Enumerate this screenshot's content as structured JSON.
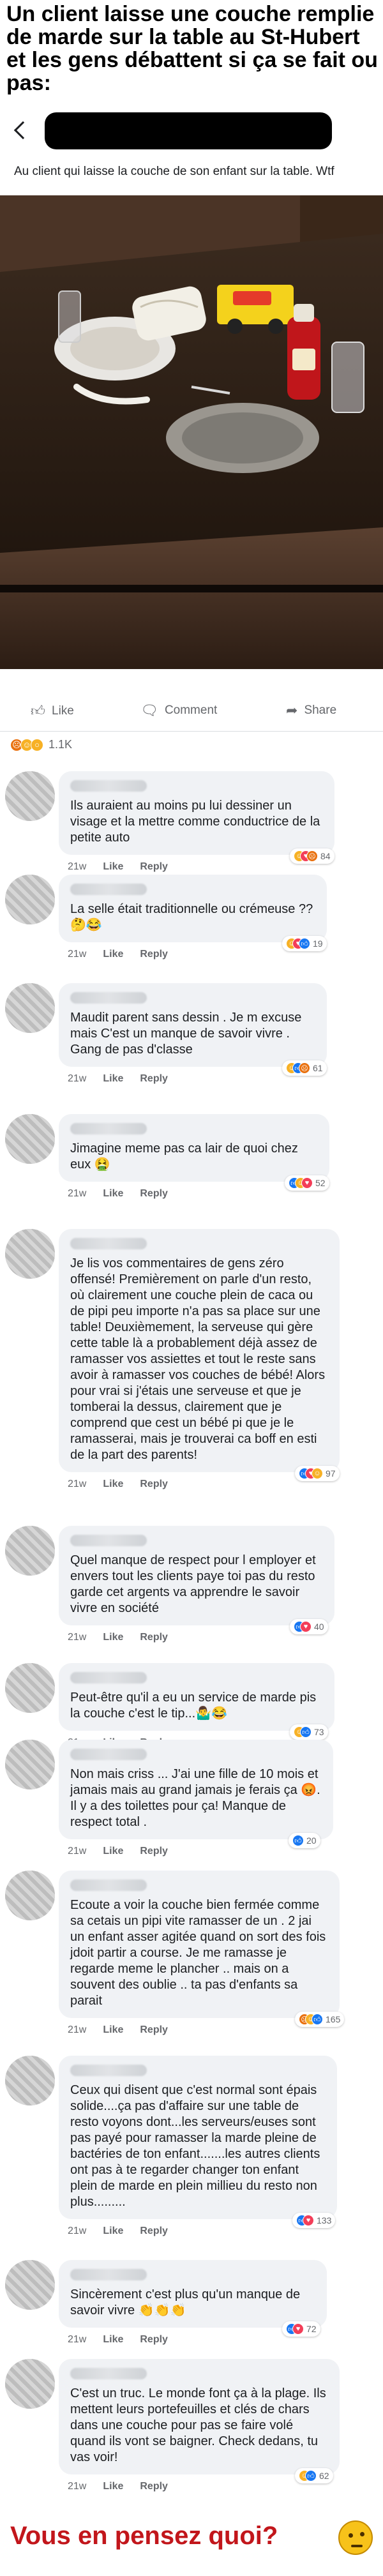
{
  "meme": {
    "title": "Un client laisse une couche remplie de marde sur la table au St-Hubert et les gens débattent si ça se fait ou pas:",
    "outro": "Vous en pensez quoi?"
  },
  "post": {
    "caption": "Au client qui laisse la couche de son enfant sur la table. Wtf",
    "photo_subject": "restaurant table with diaper, ketchup bottle, toy car box, plates and glasses"
  },
  "actions": {
    "like": "Like",
    "comment": "Comment",
    "share": "Share"
  },
  "reactions": {
    "count": "1.1K",
    "types": [
      "angry",
      "haha",
      "wow"
    ]
  },
  "comment_actions": {
    "like": "Like",
    "reply": "Reply"
  },
  "comments": [
    {
      "text": "Ils auraient au moins pu lui dessiner un visage et la mettre comme conductrice de la petite auto",
      "time": "21w",
      "reactions": [
        "haha",
        "love",
        "angry"
      ],
      "count": "84"
    },
    {
      "text": "La selle était traditionnelle ou crémeuse ?? 🤔😂",
      "time": "21w",
      "reactions": [
        "haha",
        "love",
        "like"
      ],
      "count": "19"
    },
    {
      "text": "Maudit parent sans dessin . Je m excuse mais C'est un manque de savoir vivre . Gang de pas d'classe",
      "time": "21w",
      "reactions": [
        "haha",
        "like",
        "angry"
      ],
      "count": "61"
    },
    {
      "text": "Jimagine meme pas ca lair de quoi chez eux 🤮",
      "time": "21w",
      "reactions": [
        "like",
        "haha",
        "love"
      ],
      "count": "52"
    },
    {
      "text": "Je lis vos commentaires de gens zéro offensé! Premièrement on parle d'un resto, où clairement une couche plein de caca ou de pipi peu importe n'a pas sa place sur une table! Deuxièmement, la serveuse qui gère cette table là a probablement déjà assez de ramasser vos assiettes et tout le reste sans avoir à ramasser vos couches de bébé! Alors pour vrai si j'étais une serveuse et que je tomberai la dessus, clairement que je comprend que cest un bébé pi que je le ramasserai, mais je trouverai ca boff en esti de la part des parents!",
      "time": "21w",
      "reactions": [
        "like",
        "love",
        "haha"
      ],
      "count": "97"
    },
    {
      "text": "Quel manque de respect  pour l employer et envers tout les clients  paye toi pas du resto garde cet argents va apprendre le savoir vivre en société",
      "time": "21w",
      "reactions": [
        "like",
        "love"
      ],
      "count": "40"
    },
    {
      "text": "Peut-être qu'il a eu un service de marde pis la couche c'est le tip...🤷‍♂️😂",
      "time": "21w",
      "reactions": [
        "haha",
        "like"
      ],
      "count": "73"
    },
    {
      "text": "Non mais criss ... J'ai une fille de 10 mois et jamais mais au grand jamais je ferais ça 😡. Il y a des toilettes pour ça! Manque de respect total .",
      "time": "21w",
      "reactions": [
        "like"
      ],
      "count": "20"
    },
    {
      "text": "Ecoute a voir la couche bien fermée comme sa cetais un pipi vite ramasser de un . 2 jai un enfant asser agitée quand on sort des fois jdoit partir a course. Je me ramasse je regarde meme le plancher .. mais on a souvent des oublie .. ta pas d'enfants sa parait",
      "time": "21w",
      "reactions": [
        "angry",
        "haha",
        "like"
      ],
      "count": "165"
    },
    {
      "text": "Ceux qui disent que c'est normal sont épais solide....ça pas d'affaire sur une table de resto voyons dont...les serveurs/euses sont pas payé pour ramasser la marde pleine de bactéries de ton enfant.......les autres clients ont pas à te regarder changer ton enfant plein de marde en plein millieu du resto non plus.........",
      "time": "21w",
      "reactions": [
        "like",
        "love"
      ],
      "count": "133"
    },
    {
      "text": "Sincèrement c'est plus qu'un manque de savoir vivre 👏👏👏",
      "time": "21w",
      "reactions": [
        "like",
        "love"
      ],
      "count": "72"
    },
    {
      "text": "C'est un truc. Le monde font ça à la plage. Ils mettent leurs portefeuilles et clés de chars dans une couche pour pas se faire volé quand ils vont se baigner. Check dedans, tu vas voir!",
      "time": "21w",
      "reactions": [
        "haha",
        "like"
      ],
      "count": "62"
    }
  ]
}
